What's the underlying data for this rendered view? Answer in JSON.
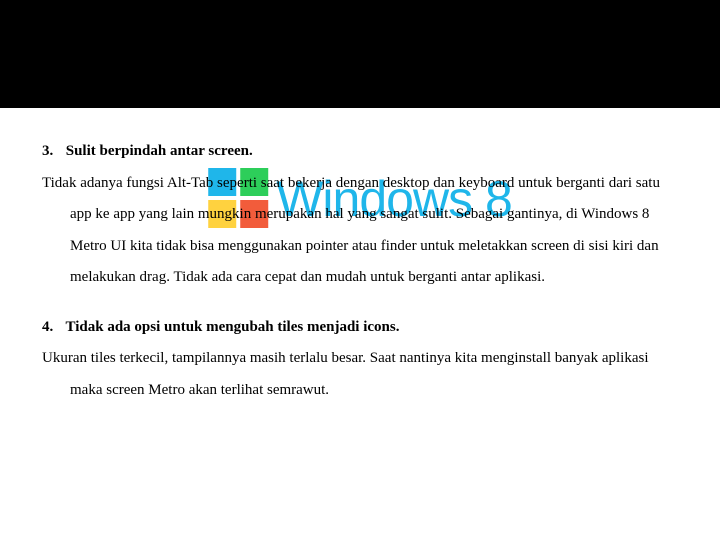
{
  "watermark": {
    "text": "Windows 8"
  },
  "items": [
    {
      "num": "3.",
      "title": "Sulit berpindah antar screen.",
      "body": "Tidak adanya fungsi Alt-Tab seperti saat bekerja dengan desktop dan keyboard untuk berganti dari satu app ke app yang lain mungkin merupakan hal yang sangat sulit. Sebagai gantinya, di Windows 8 Metro UI kita tidak bisa menggunakan pointer atau finder untuk meletakkan screen di sisi kiri dan melakukan drag. Tidak ada cara cepat dan mudah untuk berganti antar aplikasi."
    },
    {
      "num": "4.",
      "title": "Tidak ada opsi untuk mengubah tiles menjadi icons.",
      "body": "Ukuran  tiles terkecil, tampilannya masih terlalu besar. Saat nantinya kita menginstall banyak aplikasi maka screen Metro akan terlihat semrawut."
    }
  ]
}
